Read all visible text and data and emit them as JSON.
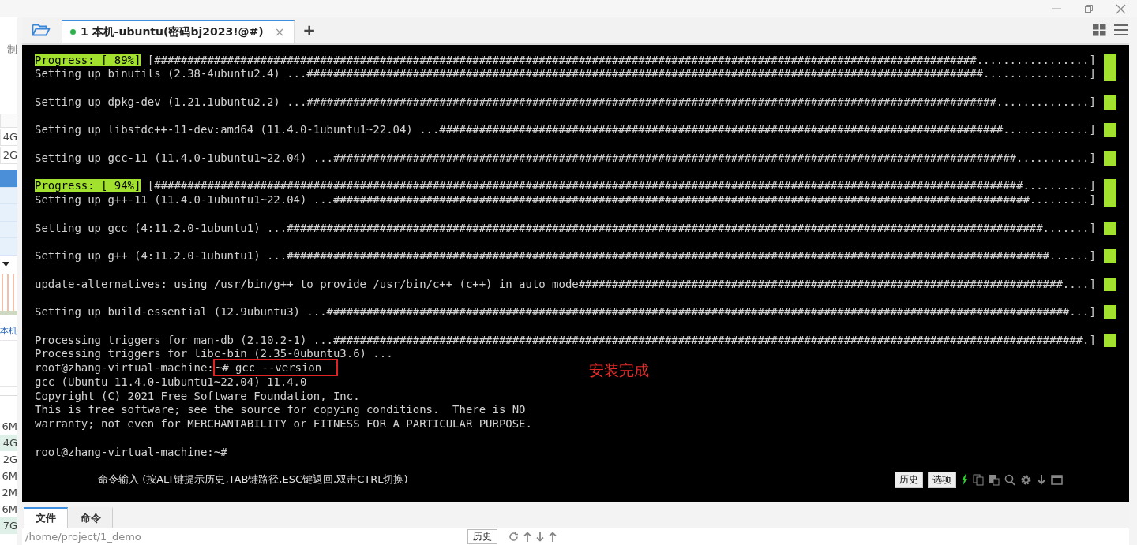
{
  "sidebar": {
    "top_label": "制",
    "fields": [
      "4G",
      "2G"
    ],
    "host_label": "本机",
    "sizes": [
      "6M",
      "4G",
      "2G",
      "6M",
      "2M",
      "6M",
      "7G"
    ]
  },
  "tabs": [
    {
      "label": "1 本机-ubuntu(密码bj2023!@#)",
      "selected": true,
      "connected": true,
      "close": "×"
    }
  ],
  "add_tab": "+",
  "terminal": {
    "lines": [
      {
        "kind": "progress",
        "label": "Progress: [ 89%]",
        "text": " [############################################################################################################################.................]"
      },
      {
        "kind": "bar",
        "text": "Setting up binutils (2.38-4ubuntu2.4) ...######################################################################################################................]"
      },
      {
        "kind": "blank"
      },
      {
        "kind": "bar",
        "text": "Setting up dpkg-dev (1.21.1ubuntu2.2) ...########################################################################################################..............]"
      },
      {
        "kind": "blank"
      },
      {
        "kind": "bar",
        "text": "Setting up libstdc++-11-dev:amd64 (11.4.0-1ubuntu1~22.04) ...#####################################################################################.............]"
      },
      {
        "kind": "blank"
      },
      {
        "kind": "bar",
        "text": "Setting up gcc-11 (11.4.0-1ubuntu1~22.04) ...#######################################################################################################...........]"
      },
      {
        "kind": "blank"
      },
      {
        "kind": "progress",
        "label": "Progress: [ 94%]",
        "text": " [###################################################################################################################################..........]"
      },
      {
        "kind": "bar",
        "text": "Setting up g++-11 (11.4.0-1ubuntu1~22.04) ...#########################################################################################################.........]"
      },
      {
        "kind": "blank"
      },
      {
        "kind": "bar",
        "text": "Setting up gcc (4:11.2.0-1ubuntu1) ...##################################################################################################################.......]"
      },
      {
        "kind": "blank"
      },
      {
        "kind": "bar",
        "text": "Setting up g++ (4:11.2.0-1ubuntu1) ...###################################################################################################################......]"
      },
      {
        "kind": "blank"
      },
      {
        "kind": "bar",
        "text": "update-alternatives: using /usr/bin/g++ to provide /usr/bin/c++ (c++) in auto mode#########################################################################....]"
      },
      {
        "kind": "blank"
      },
      {
        "kind": "bar",
        "text": "Setting up build-essential (12.9ubuntu3) ...################################################################################################################...]"
      },
      {
        "kind": "blank"
      },
      {
        "kind": "bar",
        "text": "Processing triggers for man-db (2.10.2-1) ...#################################################################################################################.]"
      },
      {
        "kind": "text",
        "text": "Processing triggers for libc-bin (2.35-0ubuntu3.6) ..."
      },
      {
        "kind": "command",
        "prompt": "root@zhang-virtual-machine:",
        "command": "~# gcc --version",
        "highlighted": true
      },
      {
        "kind": "text",
        "text": "gcc (Ubuntu 11.4.0-1ubuntu1~22.04) 11.4.0"
      },
      {
        "kind": "text",
        "text": "Copyright (C) 2021 Free Software Foundation, Inc."
      },
      {
        "kind": "text",
        "text": "This is free software; see the source for copying conditions.  There is NO"
      },
      {
        "kind": "text",
        "text": "warranty; not even for MERCHANTABILITY or FITNESS FOR A PARTICULAR PURPOSE."
      },
      {
        "kind": "blank"
      },
      {
        "kind": "command",
        "prompt": "root@zhang-virtual-machine:",
        "command": "~#",
        "highlighted": false
      }
    ],
    "annotation": "安装完成",
    "hint": "命令输入 (按ALT键提示历史,TAB键路径,ESC键返回,双击CTRL切换)",
    "buttons": [
      "历史",
      "选项"
    ]
  },
  "bottom_tabs": [
    {
      "label": "文件",
      "selected": true
    },
    {
      "label": "命令",
      "selected": false
    }
  ],
  "path": "/home/project/1_demo",
  "history_button": "历史"
}
